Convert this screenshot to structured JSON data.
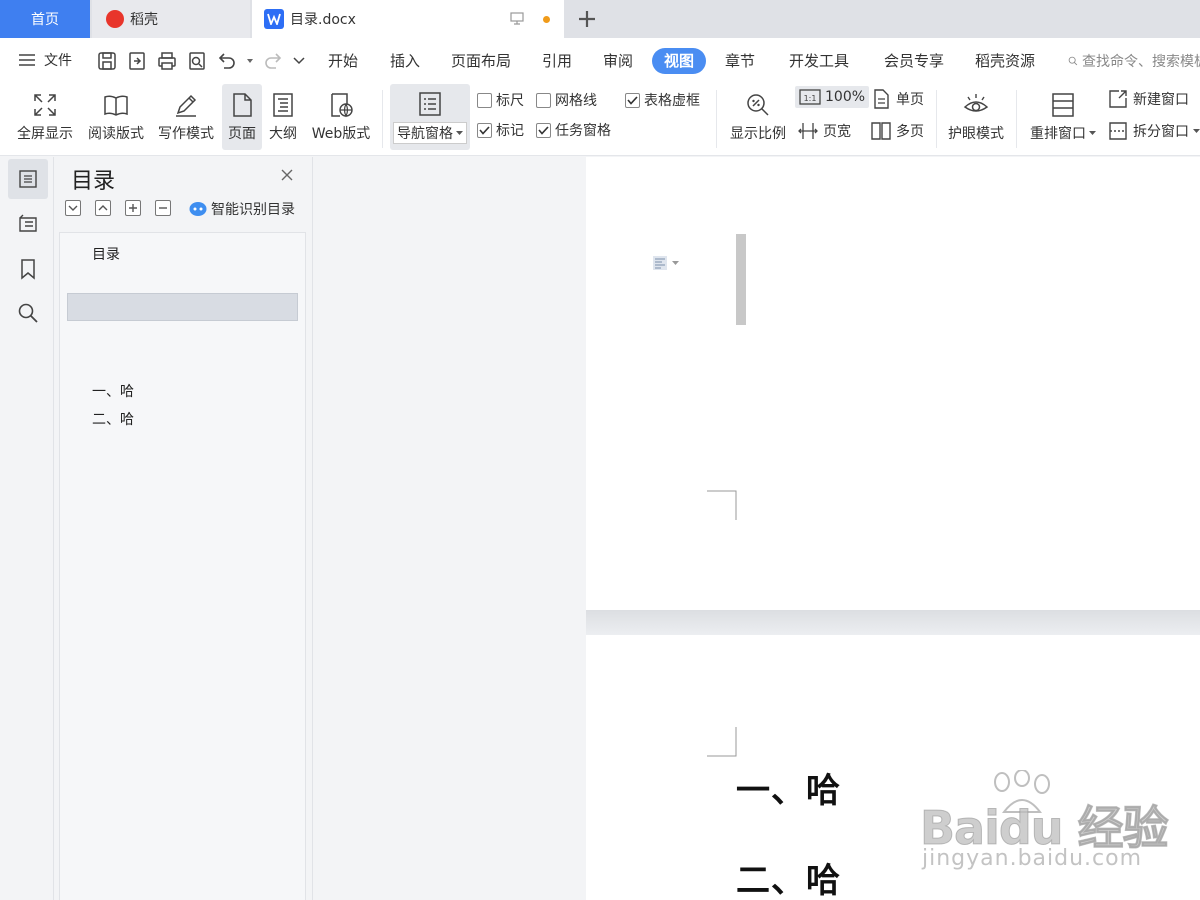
{
  "tabs": {
    "home": "首页",
    "daoke": "稻壳",
    "document": "目录.docx"
  },
  "menubar": {
    "file": "文件",
    "tabs": [
      "开始",
      "插入",
      "页面布局",
      "引用",
      "审阅",
      "视图",
      "章节",
      "开发工具",
      "会员专享",
      "稻壳资源"
    ],
    "active_tab": "视图",
    "search_placeholder": "查找命令、搜索模板"
  },
  "ribbon": {
    "fullscreen": "全屏显示",
    "reading": "阅读版式",
    "writing": "写作模式",
    "page": "页面",
    "outline": "大纲",
    "web": "Web版式",
    "nav_pane": "导航窗格",
    "ruler": "标尺",
    "gridlines": "网格线",
    "table_gridlines": "表格虚框",
    "markup": "标记",
    "task_pane": "任务窗格",
    "zoom": "显示比例",
    "zoom_level": "100%",
    "page_width": "页宽",
    "single_page": "单页",
    "multi_page": "多页",
    "eye_protect": "护眼模式",
    "arrange_windows": "重排窗口",
    "new_window": "新建窗口",
    "split_window": "拆分窗口",
    "checks": {
      "ruler": false,
      "gridlines": false,
      "table_gridlines": true,
      "markup": true,
      "task_pane": true
    }
  },
  "toc_panel": {
    "title": "目录",
    "smart_toc": "智能识别目录",
    "items": [
      "目录",
      "一、哈",
      "二、哈"
    ]
  },
  "document": {
    "headings": [
      "一、哈",
      "二、哈"
    ]
  },
  "watermark": {
    "brand": "Bai",
    "brand2": "du",
    "cn": "经验",
    "url": "jingyan.baidu.com"
  },
  "colors": {
    "accent": "#4a8df2",
    "home_tab": "#3f7ff0",
    "wps_badge": "#2d6ef5"
  }
}
